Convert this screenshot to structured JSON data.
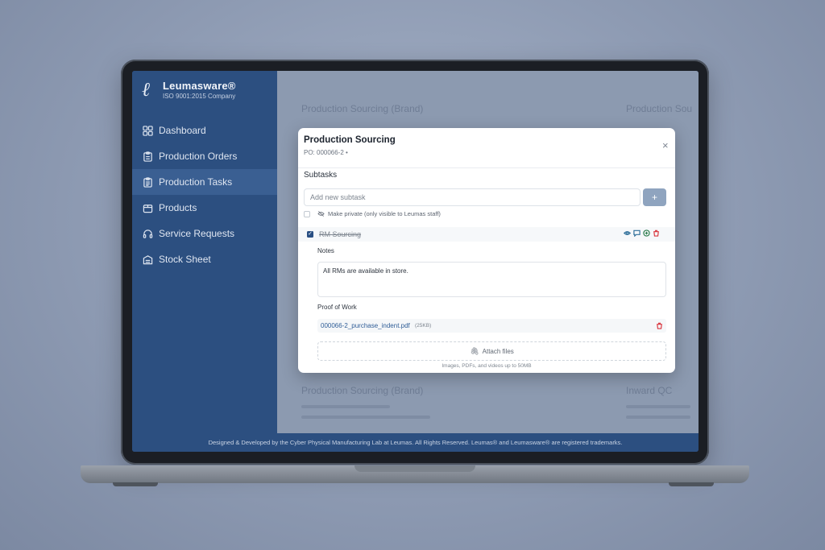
{
  "app": {
    "brand_name": "Leumasware®",
    "brand_sub": "ISO 9001:2015 Company"
  },
  "sidebar": {
    "items": [
      {
        "label": "Dashboard",
        "icon": "grid-icon"
      },
      {
        "label": "Production Orders",
        "icon": "clipboard-icon"
      },
      {
        "label": "Production Tasks",
        "icon": "clipboard-list-icon",
        "active": true
      },
      {
        "label": "Products",
        "icon": "box-icon"
      },
      {
        "label": "Service Requests",
        "icon": "headset-icon"
      },
      {
        "label": "Stock Sheet",
        "icon": "stock-icon"
      }
    ]
  },
  "background": {
    "card_titles": [
      "Production Sourcing (Brand)",
      "Production Sou",
      "Production Sourcing (Brand)",
      "Inward QC"
    ]
  },
  "modal": {
    "title": "Production Sourcing",
    "subtitle": "PO: 000066-2  •",
    "close": "×",
    "subtasks_heading": "Subtasks",
    "subtask_placeholder": "Add new subtask",
    "add_button": "+",
    "private_label": "Make private (only visible to Leumas staff)",
    "task": {
      "name": "RM Sourcing",
      "checked": true
    },
    "notes_label": "Notes",
    "notes_value": "All RMs are available in store.",
    "proof_label": "Proof of Work",
    "file": {
      "name": "000066-2_purchase_indent.pdf",
      "size": "(25KB)"
    },
    "attach_label": "Attach files",
    "attach_hint": "Images, PDFs, and videos up to 50MB"
  },
  "footer": {
    "text": "Designed & Developed by the Cyber Physical Manufacturing Lab at Leumas. All Rights Reserved. Leumas® and Leumasware® are registered trademarks."
  },
  "colors": {
    "sidebar_bg": "#2c4f80",
    "accent": "#294f83",
    "danger": "#d9363e",
    "overlay": "#8c9ab0"
  }
}
